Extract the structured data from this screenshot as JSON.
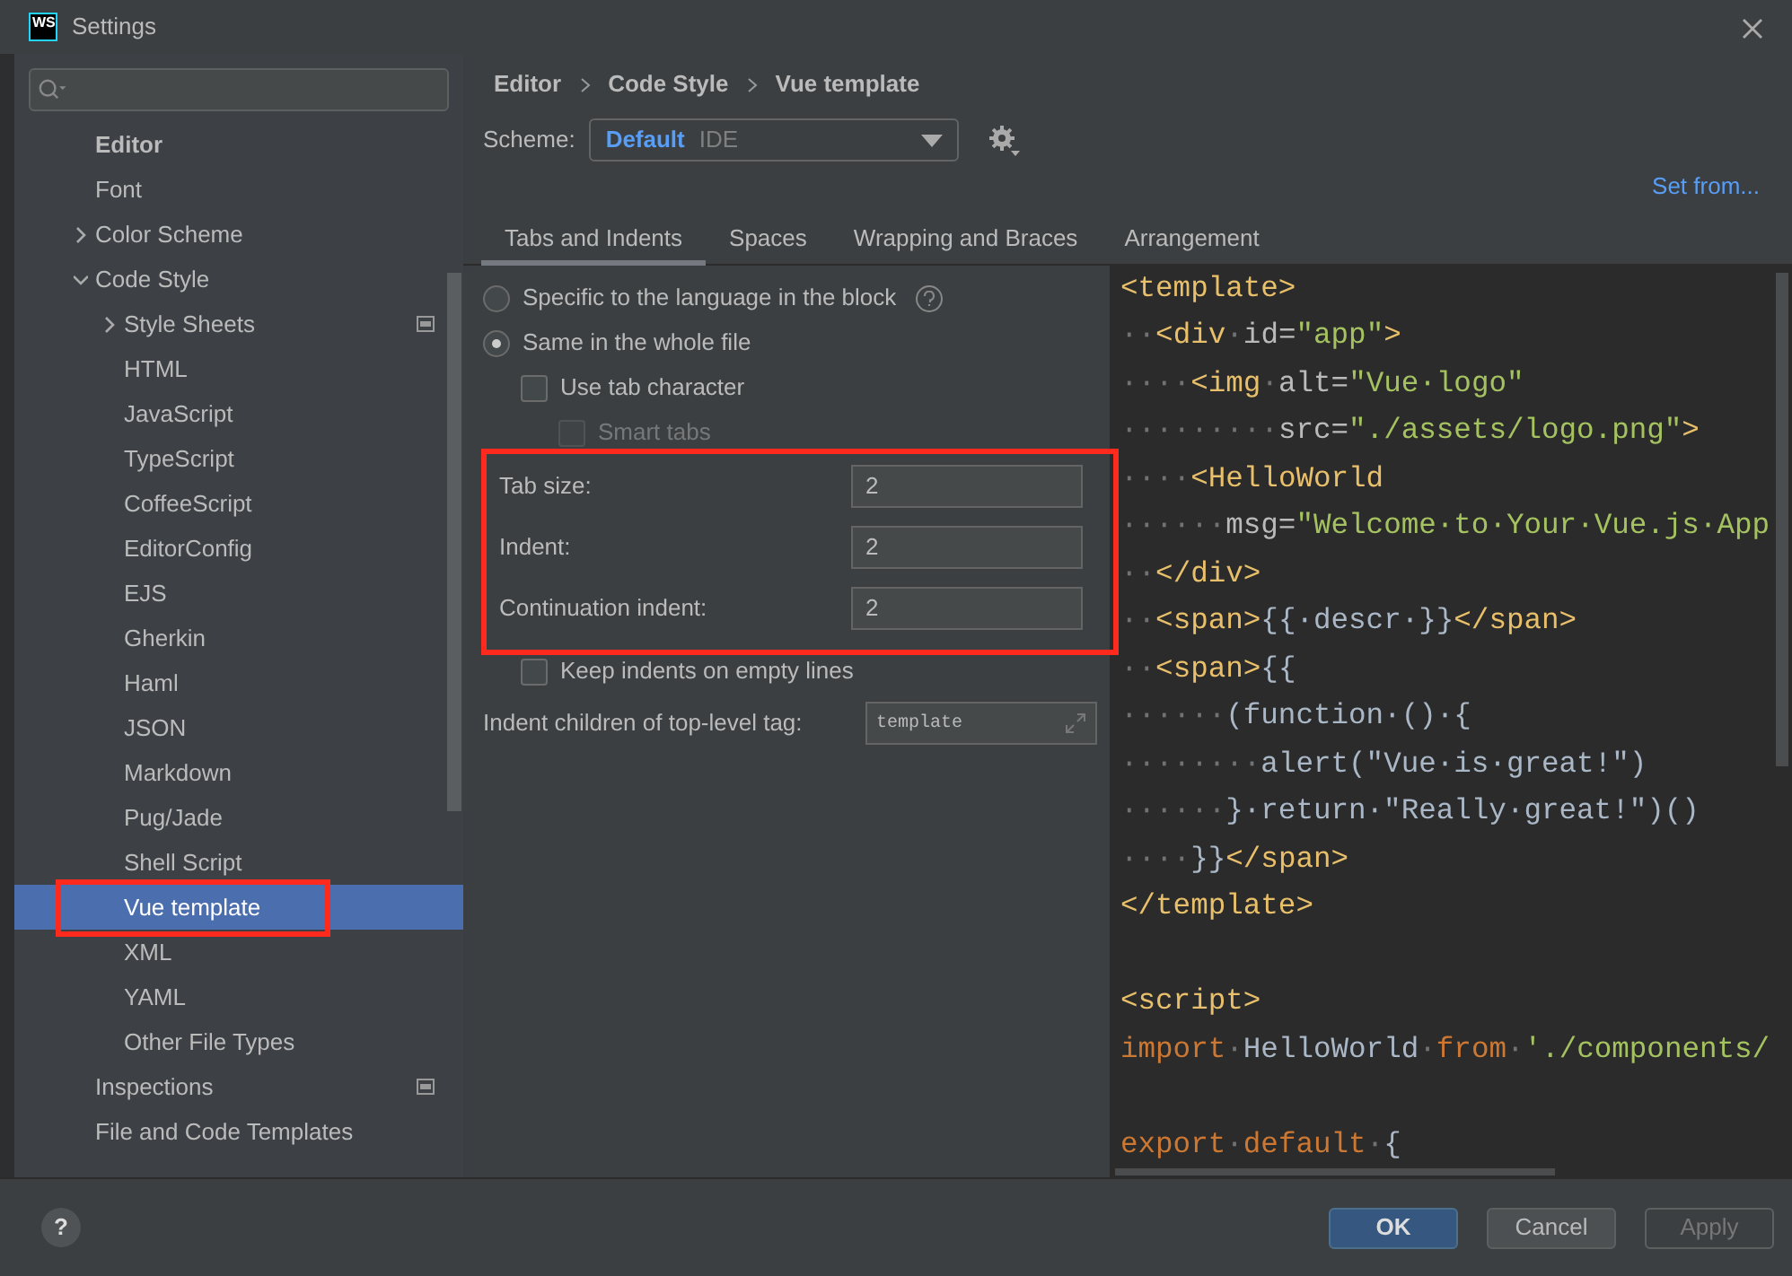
{
  "window": {
    "logo": "WS",
    "title": "Settings"
  },
  "sidebar": {
    "items": [
      {
        "label": "Editor",
        "kind": "section",
        "selected": false,
        "children": [
          {
            "label": "Font",
            "selected": false
          },
          {
            "label": "Color Scheme",
            "selected": false,
            "expanded": false
          },
          {
            "label": "Code Style",
            "selected": false,
            "expanded": true,
            "children": [
              {
                "label": "Style Sheets",
                "selected": false,
                "expanded": false,
                "scheme_icon": true
              },
              {
                "label": "HTML",
                "selected": false
              },
              {
                "label": "JavaScript",
                "selected": false
              },
              {
                "label": "TypeScript",
                "selected": false
              },
              {
                "label": "CoffeeScript",
                "selected": false
              },
              {
                "label": "EditorConfig",
                "selected": false
              },
              {
                "label": "EJS",
                "selected": false
              },
              {
                "label": "Gherkin",
                "selected": false
              },
              {
                "label": "Haml",
                "selected": false
              },
              {
                "label": "JSON",
                "selected": false
              },
              {
                "label": "Markdown",
                "selected": false
              },
              {
                "label": "Pug/Jade",
                "selected": false
              },
              {
                "label": "Shell Script",
                "selected": false
              },
              {
                "label": "Vue template",
                "selected": true
              },
              {
                "label": "XML",
                "selected": false
              },
              {
                "label": "YAML",
                "selected": false
              },
              {
                "label": "Other File Types",
                "selected": false
              }
            ]
          },
          {
            "label": "Inspections",
            "selected": false,
            "scheme_icon": true
          },
          {
            "label": "File and Code Templates",
            "selected": false
          }
        ]
      }
    ]
  },
  "breadcrumb": [
    "Editor",
    "Code Style",
    "Vue template"
  ],
  "scheme": {
    "label": "Scheme:",
    "value": "Default",
    "note": "IDE"
  },
  "set_from": "Set from...",
  "tabs": [
    {
      "label": "Tabs and Indents",
      "selected": true
    },
    {
      "label": "Spaces",
      "selected": false
    },
    {
      "label": "Wrapping and Braces",
      "selected": false
    },
    {
      "label": "Arrangement",
      "selected": false
    }
  ],
  "options": [
    {
      "kind": "radio",
      "label": "Specific to the language in the block",
      "selected": false,
      "help": true
    },
    {
      "kind": "radio",
      "label": "Same in the whole file",
      "selected": true
    },
    {
      "kind": "checkbox",
      "label": "Use tab character",
      "checked": false,
      "disabled": false
    },
    {
      "kind": "checkbox",
      "label": "Smart tabs",
      "checked": false,
      "disabled": true
    },
    {
      "kind": "field",
      "label": "Tab size:",
      "value": "2"
    },
    {
      "kind": "field",
      "label": "Indent:",
      "value": "2"
    },
    {
      "kind": "field",
      "label": "Continuation indent:",
      "value": "2"
    },
    {
      "kind": "checkbox",
      "label": "Keep indents on empty lines",
      "checked": false,
      "disabled": false
    },
    {
      "kind": "expandable",
      "label": "Indent children of top-level tag:",
      "value": "template"
    }
  ],
  "code": [
    {
      "tokens": [
        {
          "kind": "tag",
          "text": "<template>"
        }
      ]
    },
    {
      "tokens": [
        {
          "kind": "ws",
          "text": "··"
        },
        {
          "kind": "tag",
          "text": "<div"
        },
        {
          "kind": "ws",
          "text": "·"
        },
        {
          "kind": "attr",
          "text": "id="
        },
        {
          "kind": "string",
          "text": "\"app\""
        },
        {
          "kind": "tag",
          "text": ">"
        }
      ]
    },
    {
      "tokens": [
        {
          "kind": "ws",
          "text": "····"
        },
        {
          "kind": "tag",
          "text": "<img"
        },
        {
          "kind": "ws",
          "text": "·"
        },
        {
          "kind": "attr",
          "text": "alt="
        },
        {
          "kind": "string",
          "text": "\"Vue·logo\""
        }
      ]
    },
    {
      "tokens": [
        {
          "kind": "ws",
          "text": "·········"
        },
        {
          "kind": "attr",
          "text": "src="
        },
        {
          "kind": "string",
          "text": "\"./assets/logo.png\""
        },
        {
          "kind": "tag",
          "text": ">"
        }
      ]
    },
    {
      "tokens": [
        {
          "kind": "ws",
          "text": "····"
        },
        {
          "kind": "tag",
          "text": "<HelloWorld"
        }
      ]
    },
    {
      "tokens": [
        {
          "kind": "ws",
          "text": "······"
        },
        {
          "kind": "attr",
          "text": "msg="
        },
        {
          "kind": "string",
          "text": "\"Welcome·to·Your·Vue.js·App"
        }
      ]
    },
    {
      "tokens": [
        {
          "kind": "ws",
          "text": "··"
        },
        {
          "kind": "tag",
          "text": "</div>"
        }
      ]
    },
    {
      "tokens": [
        {
          "kind": "ws",
          "text": "··"
        },
        {
          "kind": "tag",
          "text": "<span>"
        },
        {
          "kind": "plain",
          "text": "{{·descr·}}"
        },
        {
          "kind": "tag",
          "text": "</span>"
        }
      ]
    },
    {
      "tokens": [
        {
          "kind": "ws",
          "text": "··"
        },
        {
          "kind": "tag",
          "text": "<span>"
        },
        {
          "kind": "plain",
          "text": "{{"
        }
      ]
    },
    {
      "tokens": [
        {
          "kind": "ws",
          "text": "······"
        },
        {
          "kind": "plain",
          "text": "(function·()·{"
        }
      ]
    },
    {
      "tokens": [
        {
          "kind": "ws",
          "text": "········"
        },
        {
          "kind": "plain",
          "text": "alert(\"Vue·is·great!\")"
        }
      ]
    },
    {
      "tokens": [
        {
          "kind": "ws",
          "text": "······"
        },
        {
          "kind": "plain",
          "text": "}·return·\"Really·great!\")()"
        }
      ]
    },
    {
      "tokens": [
        {
          "kind": "ws",
          "text": "····"
        },
        {
          "kind": "plain",
          "text": "}}"
        },
        {
          "kind": "tag",
          "text": "</span>"
        }
      ]
    },
    {
      "tokens": [
        {
          "kind": "tag",
          "text": "</template>"
        }
      ]
    },
    {
      "kind": "blank"
    },
    {
      "tokens": [
        {
          "kind": "tag",
          "text": "<script>"
        }
      ]
    },
    {
      "tokens": [
        {
          "kind": "keyword",
          "text": "import"
        },
        {
          "kind": "ws",
          "text": "·"
        },
        {
          "kind": "plain",
          "text": "HelloWorld"
        },
        {
          "kind": "ws",
          "text": "·"
        },
        {
          "kind": "keyword",
          "text": "from"
        },
        {
          "kind": "ws",
          "text": "·"
        },
        {
          "kind": "string",
          "text": "'./components/"
        }
      ]
    },
    {
      "kind": "blank"
    },
    {
      "tokens": [
        {
          "kind": "keyword",
          "text": "export"
        },
        {
          "kind": "ws",
          "text": "·"
        },
        {
          "kind": "keyword",
          "text": "default"
        },
        {
          "kind": "ws",
          "text": "·"
        },
        {
          "kind": "plain",
          "text": "{"
        }
      ]
    }
  ],
  "buttons": [
    {
      "label": "OK",
      "kind": "primary",
      "disabled": false
    },
    {
      "label": "Cancel",
      "kind": "secondary",
      "disabled": false
    },
    {
      "label": "Apply",
      "kind": "secondary",
      "disabled": true
    }
  ],
  "help_button": "?"
}
